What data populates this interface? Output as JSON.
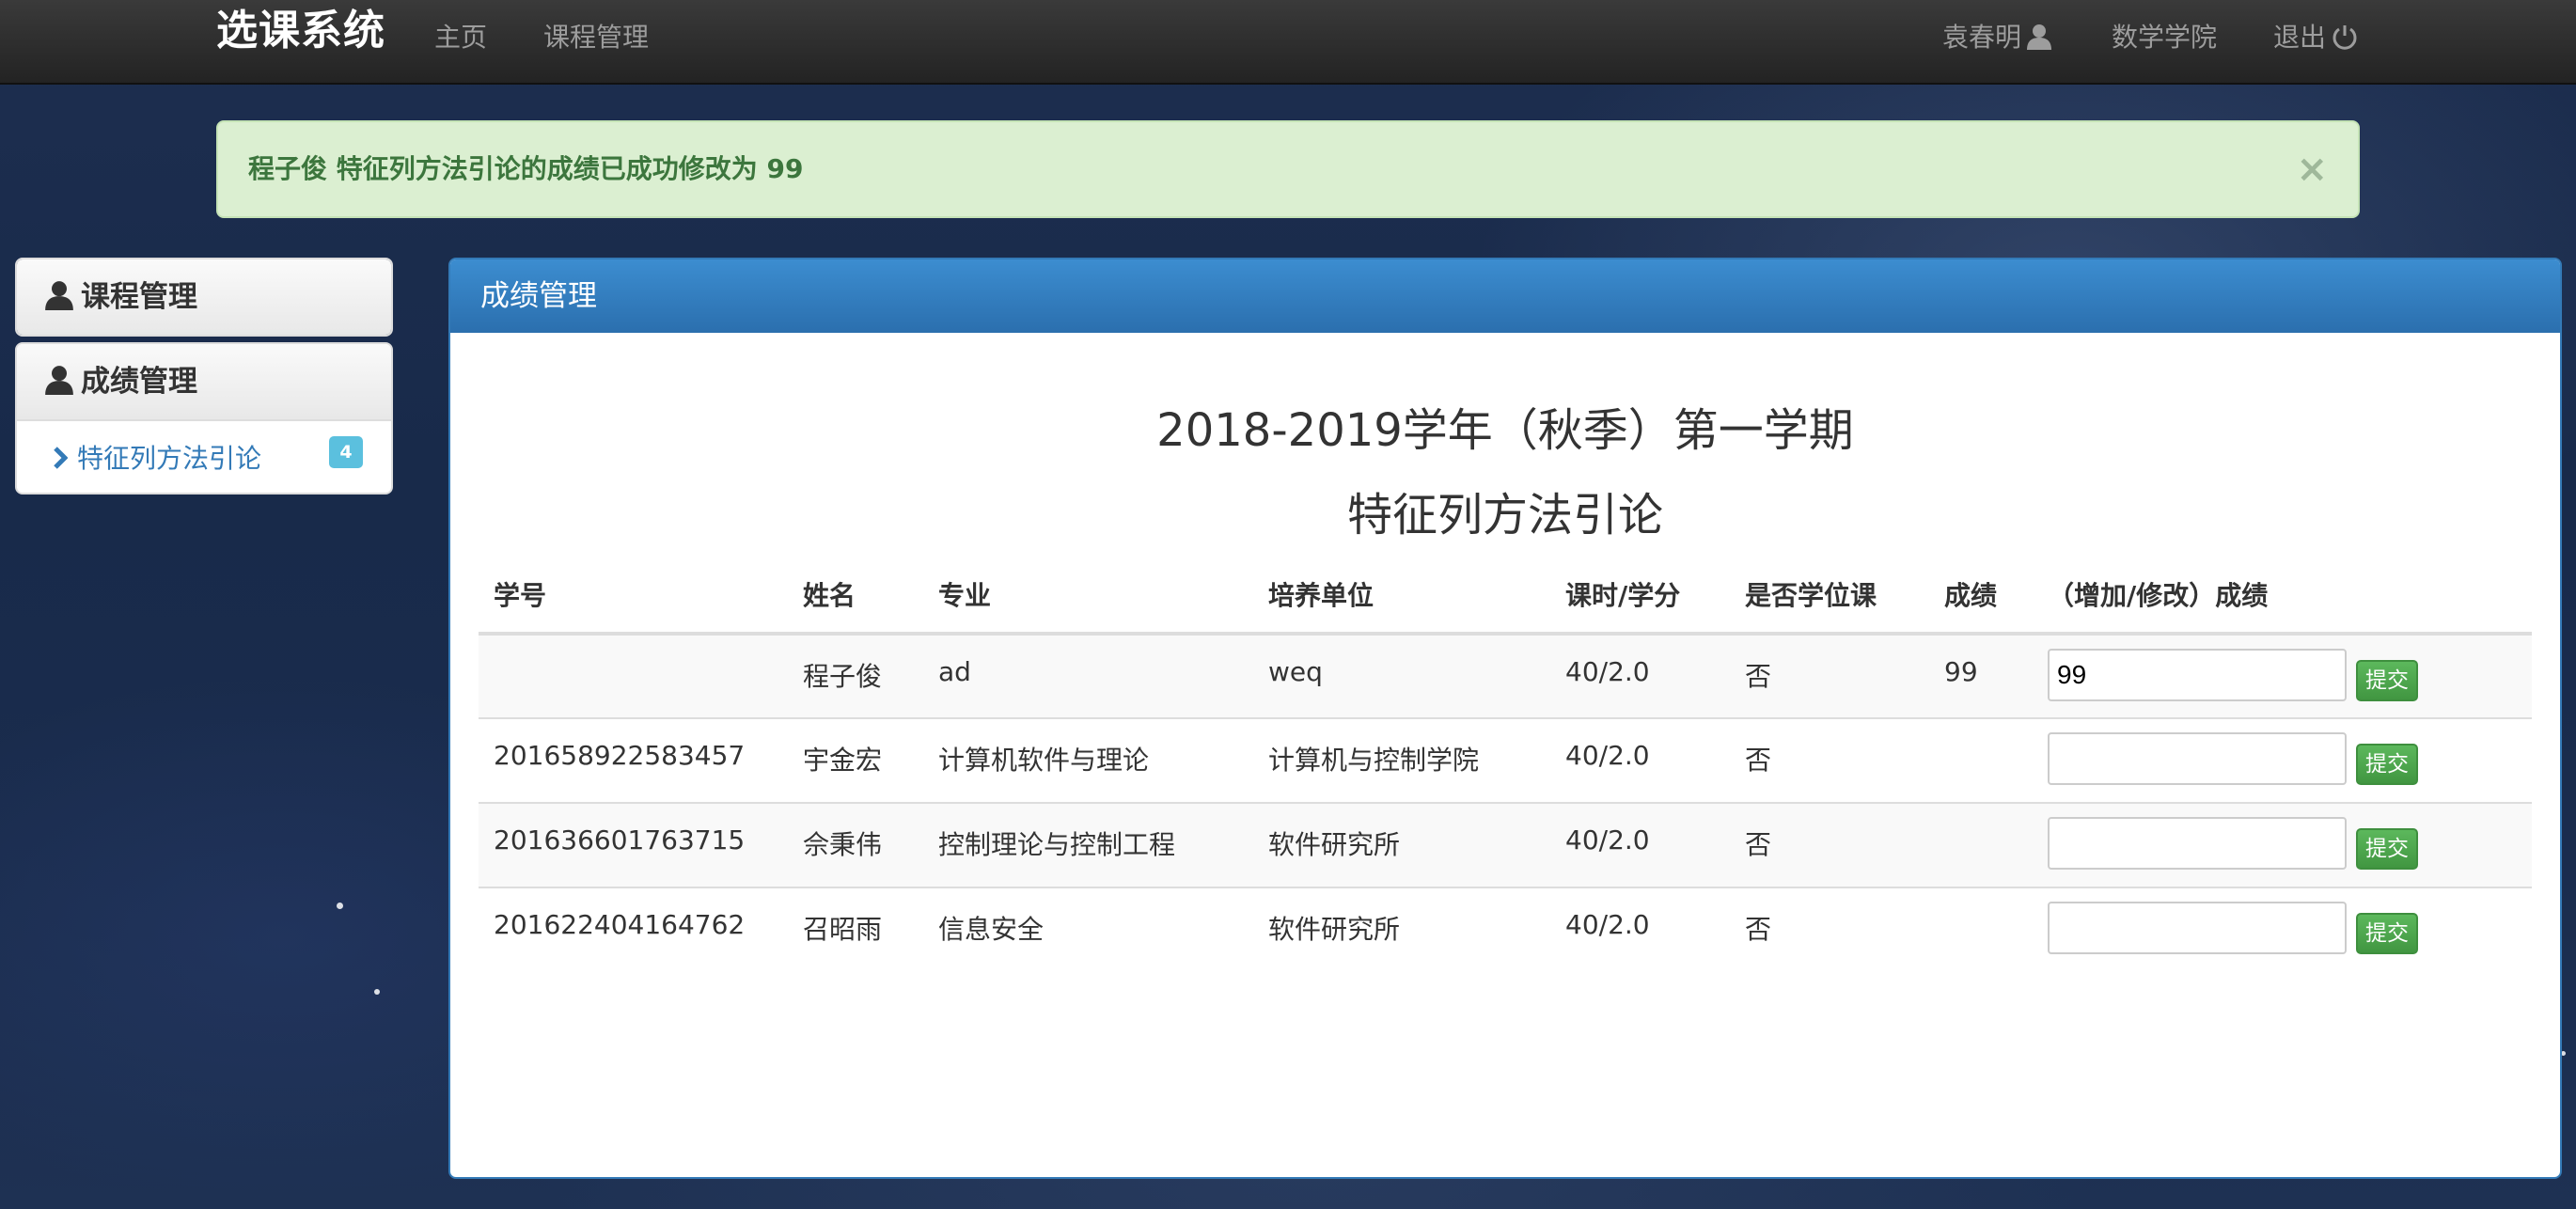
{
  "navbar": {
    "brand": "选课系统",
    "home": "主页",
    "course_mgmt": "课程管理",
    "user_name": "袁春明",
    "department": "数学学院",
    "logout": "退出"
  },
  "alert": {
    "message": "程子俊 特征列方法引论的成绩已成功修改为 99",
    "close": "×"
  },
  "sidebar": {
    "panels": [
      {
        "label": "课程管理",
        "icon": "user-icon"
      },
      {
        "label": "成绩管理",
        "icon": "user-icon",
        "items": [
          {
            "label": "特征列方法引论",
            "badge": "4"
          }
        ]
      }
    ]
  },
  "main": {
    "panel_title": "成绩管理",
    "term_title": "2018-2019学年（秋季）第一学期",
    "course_title": "特征列方法引论",
    "columns": [
      "学号",
      "姓名",
      "专业",
      "培养单位",
      "课时/学分",
      "是否学位课",
      "成绩",
      "（增加/修改）成绩"
    ],
    "submit_label": "提交",
    "rows": [
      {
        "id": "",
        "name": "程子俊",
        "major": "ad",
        "unit": "weq",
        "hours": "40/2.0",
        "degree": "否",
        "grade": "99",
        "input": "99"
      },
      {
        "id": "201658922583457",
        "name": "宇金宏",
        "major": "计算机软件与理论",
        "unit": "计算机与控制学院",
        "hours": "40/2.0",
        "degree": "否",
        "grade": "",
        "input": ""
      },
      {
        "id": "201636601763715",
        "name": "佘秉伟",
        "major": "控制理论与控制工程",
        "unit": "软件研究所",
        "hours": "40/2.0",
        "degree": "否",
        "grade": "",
        "input": ""
      },
      {
        "id": "201622404164762",
        "name": "召昭雨",
        "major": "信息安全",
        "unit": "软件研究所",
        "hours": "40/2.0",
        "degree": "否",
        "grade": "",
        "input": ""
      }
    ]
  }
}
